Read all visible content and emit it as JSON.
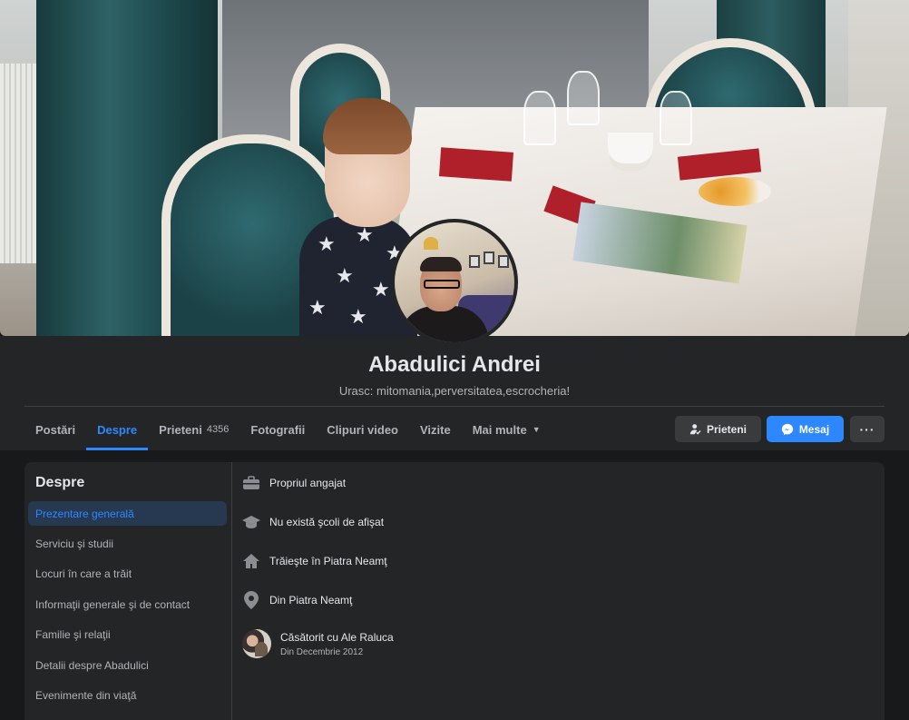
{
  "profile": {
    "name": "Abadulici Andrei",
    "bio": "Urasc: mitomania,perversitatea,escrocheria!"
  },
  "tabs": [
    {
      "label": "Postări"
    },
    {
      "label": "Despre",
      "active": true
    },
    {
      "label": "Prieteni",
      "count": "4356"
    },
    {
      "label": "Fotografii"
    },
    {
      "label": "Clipuri video"
    },
    {
      "label": "Vizite"
    },
    {
      "label": "Mai multe"
    }
  ],
  "actions": {
    "friends_label": "Prieteni",
    "message_label": "Mesaj",
    "more_label": "···"
  },
  "about": {
    "title": "Despre",
    "sections": [
      {
        "label": "Prezentare generală",
        "active": true
      },
      {
        "label": "Serviciu şi studii"
      },
      {
        "label": "Locuri în care a trăit"
      },
      {
        "label": "Informaţii generale şi de contact"
      },
      {
        "label": "Familie şi relaţii"
      },
      {
        "label": "Detalii despre Abadulici"
      },
      {
        "label": "Evenimente din viaţă"
      }
    ],
    "overview": [
      {
        "icon": "briefcase-icon",
        "text": "Propriul angajat"
      },
      {
        "icon": "graduation-cap-icon",
        "text": "Nu există şcoli de afişat"
      },
      {
        "icon": "home-icon",
        "text": "Trăieşte în Piatra Neamţ"
      },
      {
        "icon": "location-pin-icon",
        "text": "Din Piatra Neamţ"
      },
      {
        "icon": "spouse-avatar",
        "text": "Căsătorit cu Ale Raluca",
        "sub": "Din Decembrie 2012"
      }
    ]
  },
  "colors": {
    "accent": "#2d88ff",
    "background": "#18191a",
    "card": "#242526"
  }
}
